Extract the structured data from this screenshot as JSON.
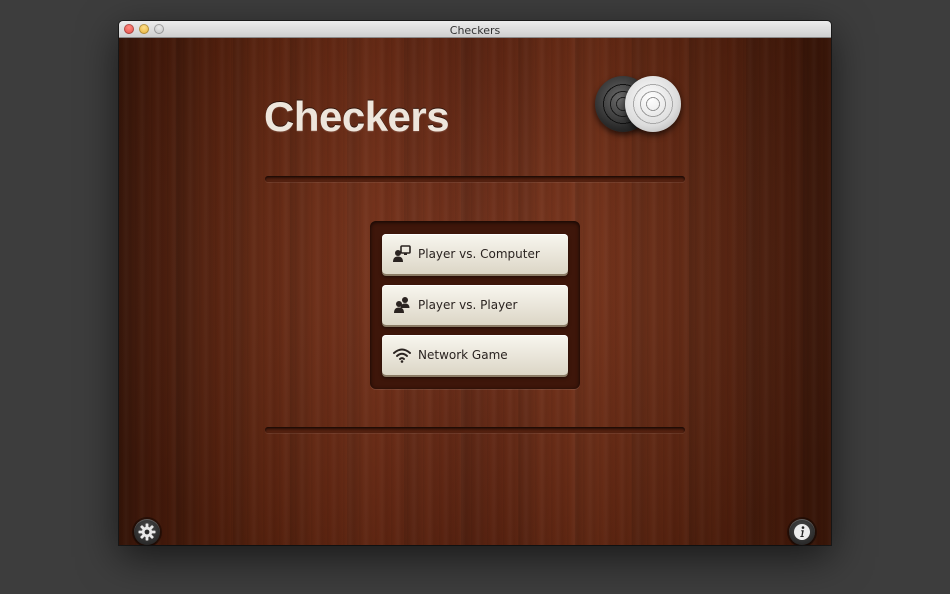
{
  "window": {
    "title": "Checkers"
  },
  "app": {
    "title": "Checkers",
    "logo_icon": "checker-pieces-icon"
  },
  "menu": {
    "items": [
      {
        "label": "Player vs. Computer",
        "icon": "player-vs-computer-icon"
      },
      {
        "label": "Player vs. Player",
        "icon": "player-vs-player-icon"
      },
      {
        "label": "Network Game",
        "icon": "wifi-icon"
      }
    ]
  },
  "footer": {
    "settings_icon": "gear-icon",
    "info_icon": "info-icon"
  },
  "colors": {
    "wood": "#6e2b12",
    "button_face": "#ece8dc",
    "title_text": "#eee6dc"
  }
}
